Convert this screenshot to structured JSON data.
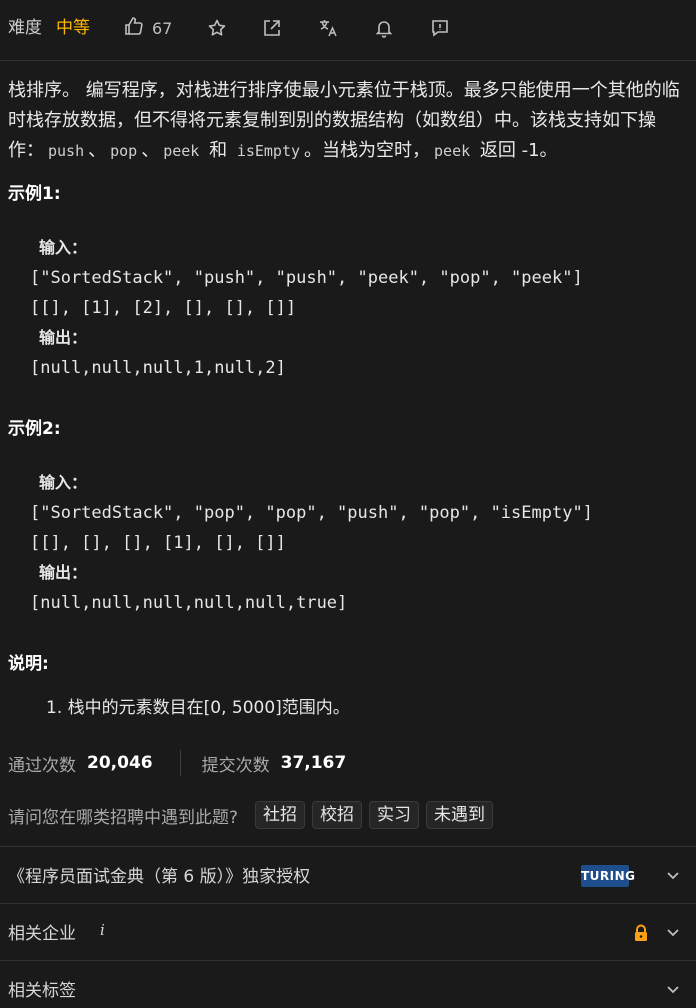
{
  "header": {
    "difficulty_label": "难度",
    "difficulty_value": "中等",
    "like_count": "67",
    "colors": {
      "difficulty": "#ffb800"
    }
  },
  "description": {
    "part1": "栈排序。 编写程序，对栈进行排序使最小元素位于栈顶。最多只能使用一个其他的临时栈存放数据，但不得将元素复制到别的数据结构（如数组）中。该栈支持如下操作：",
    "op_push": "push",
    "sep1": "、",
    "op_pop": "pop",
    "sep2": "、",
    "op_peek": "peek",
    "and": "和",
    "op_isempty": "isEmpty",
    "part2": "。当栈为空时，",
    "op_peek2": "peek",
    "part3": "返回 -1。"
  },
  "example1": {
    "title": "示例1:",
    "input_label": "输入：",
    "line1": "[\"SortedStack\", \"push\", \"push\", \"peek\", \"pop\", \"peek\"]",
    "line2": "[[], [1], [2], [], [], []]",
    "output_label": "输出：",
    "output": "[null,null,null,1,null,2]"
  },
  "example2": {
    "title": "示例2:",
    "input_label": "输入：",
    "line1": "[\"SortedStack\", \"pop\", \"pop\", \"push\", \"pop\", \"isEmpty\"]",
    "line2": "[[], [], [], [1], [], []]",
    "output_label": "输出：",
    "output": "[null,null,null,null,null,true]"
  },
  "notes": {
    "title": "说明:",
    "item1": "1. 栈中的元素数目在[0, 5000]范围内。"
  },
  "stats": {
    "accepted_label": "通过次数",
    "accepted_value": "20,046",
    "submitted_label": "提交次数",
    "submitted_value": "37,167"
  },
  "ask": {
    "label": "请问您在哪类招聘中遇到此题?",
    "options": [
      "社招",
      "校招",
      "实习",
      "未遇到"
    ]
  },
  "sections": {
    "book": "《程序员面试金典（第 6 版）》独家授权",
    "book_logo": "TURING",
    "companies": "相关企业",
    "companies_info": "i",
    "tags": "相关标签"
  }
}
